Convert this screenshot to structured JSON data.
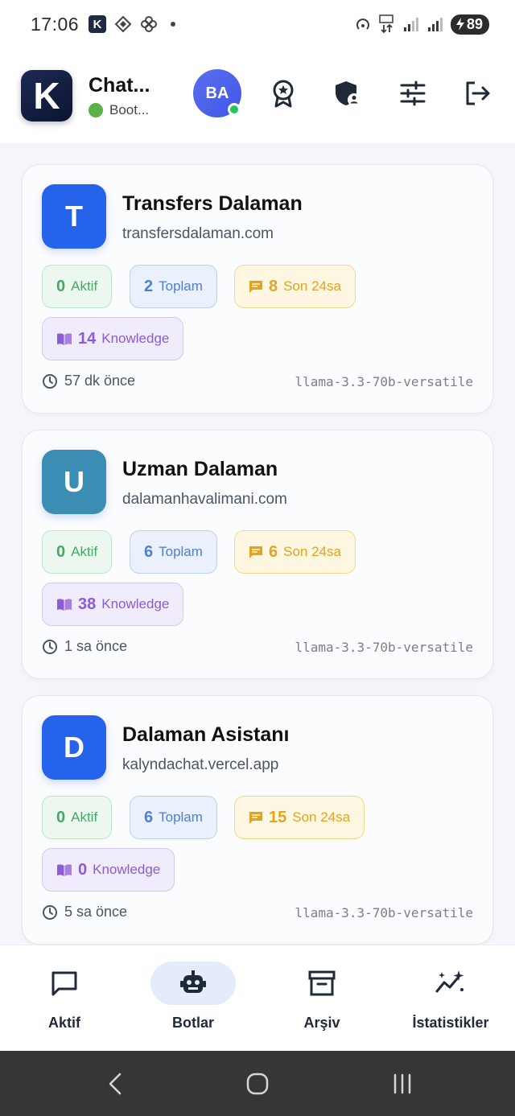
{
  "status_bar": {
    "time": "17:06",
    "battery": "89"
  },
  "header": {
    "logo_letter": "K",
    "title": "Chat...",
    "subtitle": "Boot...",
    "avatar_initials": "BA"
  },
  "bots": [
    {
      "letter": "T",
      "color": "#2563eb",
      "name": "Transfers Dalaman",
      "domain": "transfersdalaman.com",
      "active_count": "0",
      "active_label": "Aktif",
      "total_count": "2",
      "total_label": "Toplam",
      "recent_count": "8",
      "recent_label": "Son 24sa",
      "knowledge_count": "14",
      "knowledge_label": "Knowledge",
      "last_seen": "57 dk önce",
      "model": "llama-3.3-70b-versatile"
    },
    {
      "letter": "U",
      "color": "#3b8db3",
      "name": "Uzman Dalaman",
      "domain": "dalamanhavalimani.com",
      "active_count": "0",
      "active_label": "Aktif",
      "total_count": "6",
      "total_label": "Toplam",
      "recent_count": "6",
      "recent_label": "Son 24sa",
      "knowledge_count": "38",
      "knowledge_label": "Knowledge",
      "last_seen": "1 sa önce",
      "model": "llama-3.3-70b-versatile"
    },
    {
      "letter": "D",
      "color": "#2563eb",
      "name": "Dalaman Asistanı",
      "domain": "kalyndachat.vercel.app",
      "active_count": "0",
      "active_label": "Aktif",
      "total_count": "6",
      "total_label": "Toplam",
      "recent_count": "15",
      "recent_label": "Son 24sa",
      "knowledge_count": "0",
      "knowledge_label": "Knowledge",
      "last_seen": "5 sa önce",
      "model": "llama-3.3-70b-versatile"
    }
  ],
  "bottom_nav": {
    "items": [
      {
        "label": "Aktif",
        "icon": "chat-bubble-icon"
      },
      {
        "label": "Botlar",
        "icon": "robot-icon"
      },
      {
        "label": "Arşiv",
        "icon": "archive-icon"
      },
      {
        "label": "İstatistikler",
        "icon": "sparkle-chart-icon"
      }
    ],
    "active_index": 1
  },
  "colors": {
    "accent": "#2563eb",
    "online": "#22c55e"
  }
}
